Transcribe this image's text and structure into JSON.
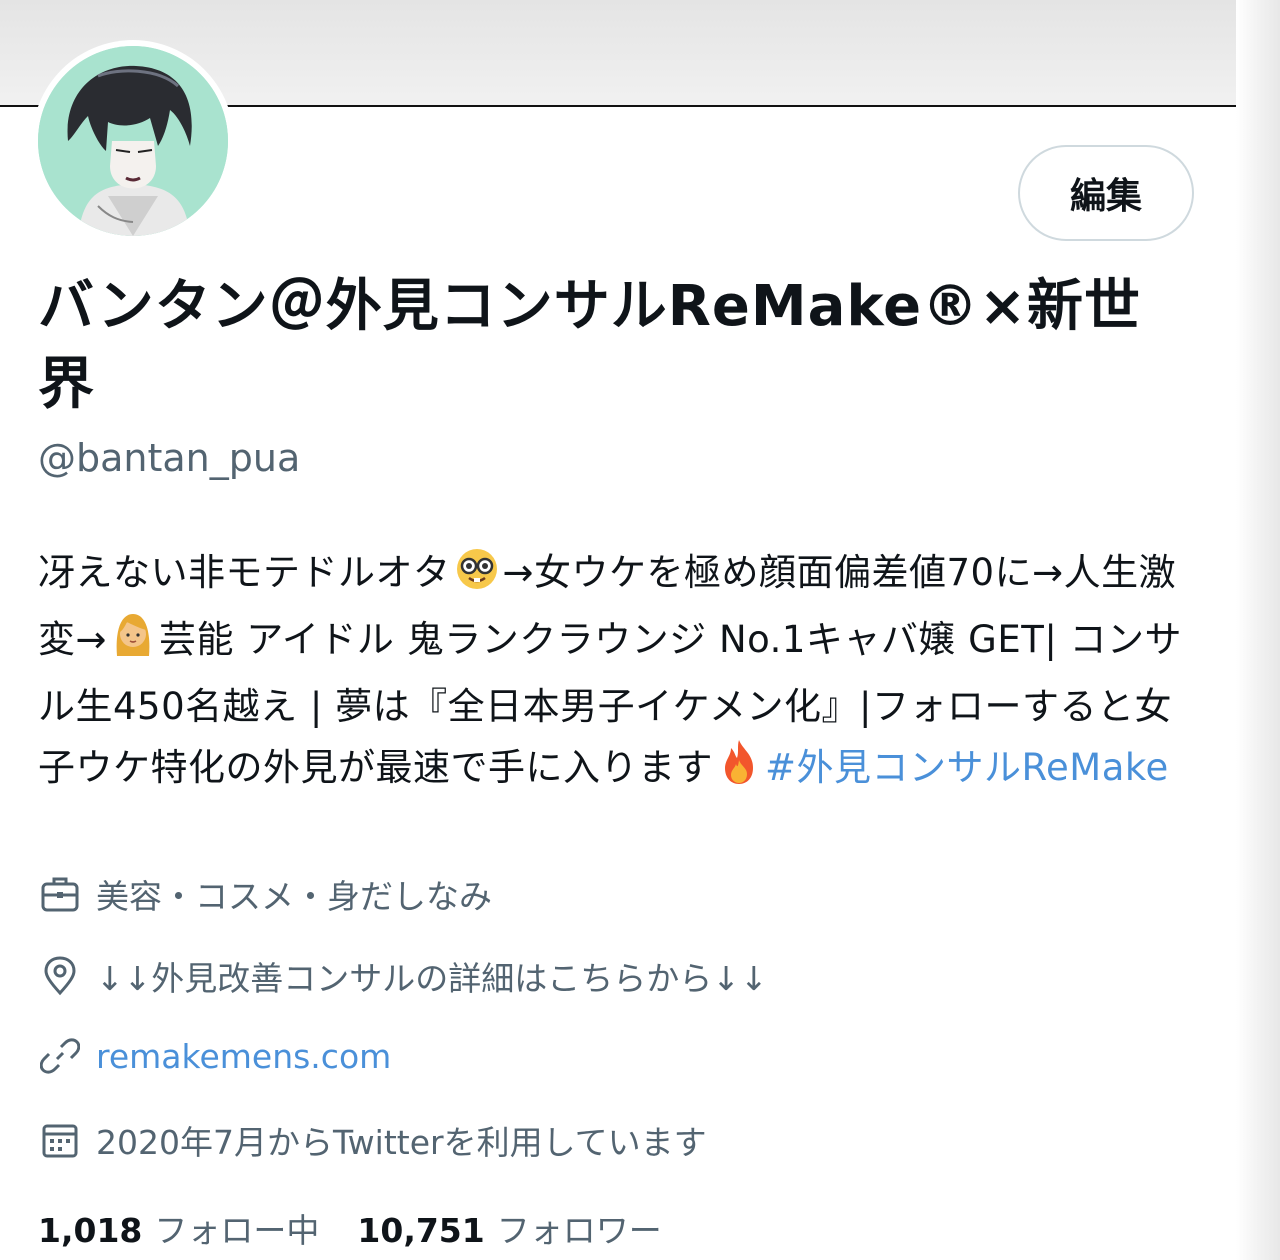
{
  "profile": {
    "edit_label": "編集",
    "display_name": "バンタン＠外見コンサルReMake®×新世界",
    "handle": "@bantan_pua"
  },
  "bio": {
    "part1": "冴えない非モテドルオタ",
    "part2": "→女ウケを極め顔面偏差値70に→人生激変→",
    "part3": "芸能 アイドル 鬼ランクラウンジ No.1キャバ嬢 GET| コンサル生450名越え | 夢は『全日本男子イケメン化』|フォローすると女子ウケ特化の外見が最速で手に入ります",
    "hashtag": "#外見コンサルReMake",
    "emoji_1": "nerd-face",
    "emoji_2": "woman",
    "emoji_3": "fire"
  },
  "meta": {
    "category": "美容・コスメ・身だしなみ",
    "category_icon": "briefcase-icon",
    "location": "↓↓外見改善コンサルの詳細はこちらから↓↓",
    "location_icon": "location-pin-icon",
    "website": "remakemens.com",
    "website_icon": "link-icon",
    "joined": "2020年7月からTwitterを利用しています",
    "joined_icon": "calendar-icon"
  },
  "stats": {
    "following_count": "1,018",
    "following_label": "フォロー中",
    "followers_count": "10,751",
    "followers_label": "フォロワー"
  },
  "colors": {
    "link": "#4a90d9",
    "secondary_text": "#536471",
    "primary_text": "#0f1419"
  }
}
